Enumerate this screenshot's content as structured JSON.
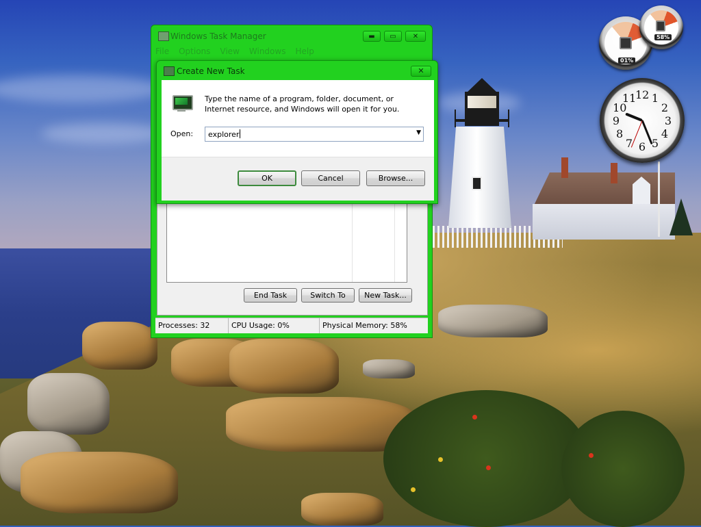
{
  "task_manager": {
    "title": "Windows Task Manager",
    "menu": [
      "File",
      "Options",
      "View",
      "Windows",
      "Help"
    ],
    "buttons": {
      "minimize": "▬",
      "maximize": "▭",
      "close": "✕",
      "end_task": "End Task",
      "switch_to": "Switch To",
      "new_task": "New Task..."
    },
    "status": {
      "processes": "Processes: 32",
      "cpu": "CPU Usage: 0%",
      "memory": "Physical Memory: 58%"
    }
  },
  "dialog": {
    "title": "Create New Task",
    "close": "✕",
    "description": "Type the name of a program, folder, document, or Internet resource, and Windows will open it for you.",
    "open_label": "Open:",
    "open_value": "explorer",
    "ok": "OK",
    "cancel": "Cancel",
    "browse": "Browse..."
  },
  "gadgets": {
    "cpu_meter": {
      "cpu": "01%",
      "memory": "58%"
    },
    "clock": {
      "numerals": [
        "12",
        "1",
        "2",
        "3",
        "4",
        "5",
        "6",
        "7",
        "8",
        "9",
        "10",
        "11"
      ]
    }
  },
  "colors": {
    "window_frame": "#22d11f",
    "dialog_body": "#ffffff",
    "button_face": "#e4e4e4"
  }
}
